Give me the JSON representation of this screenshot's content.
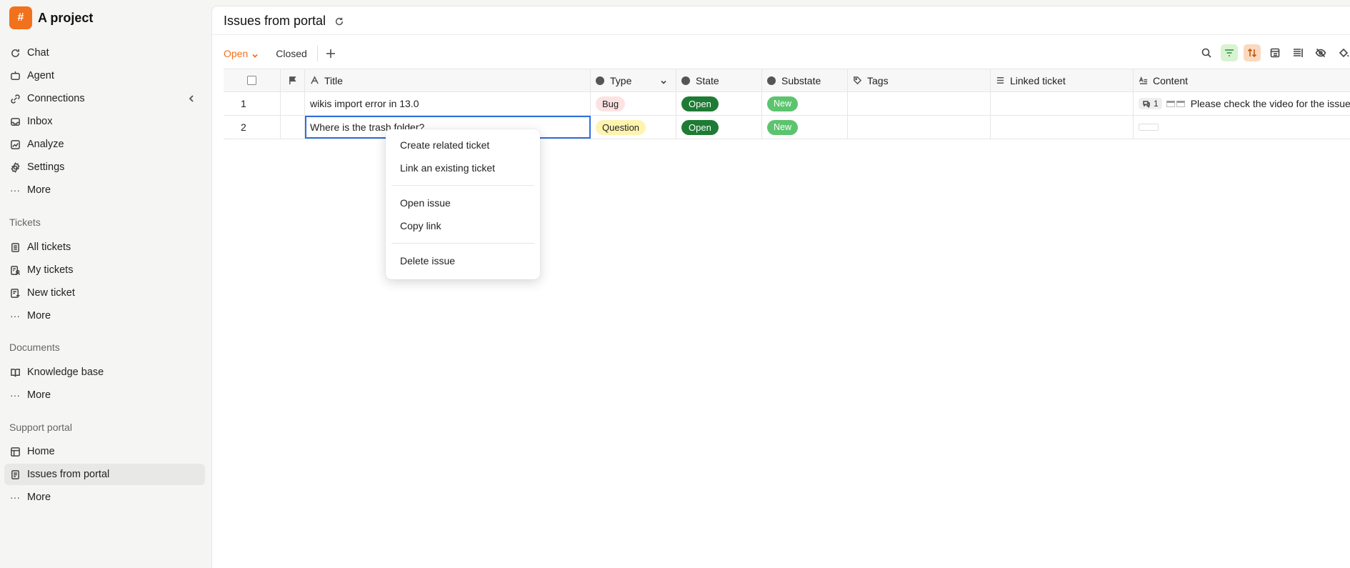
{
  "project": {
    "name": "A project",
    "logo_glyph": "#",
    "accent": "#f2711c"
  },
  "sidebar": {
    "main_items": [
      {
        "label": "Chat",
        "icon": "chat-icon"
      },
      {
        "label": "Agent",
        "icon": "agent-icon"
      },
      {
        "label": "Connections",
        "icon": "connections-icon"
      },
      {
        "label": "Inbox",
        "icon": "inbox-icon"
      },
      {
        "label": "Analyze",
        "icon": "analyze-icon"
      },
      {
        "label": "Settings",
        "icon": "settings-icon"
      },
      {
        "label": "More",
        "icon": "more-icon"
      }
    ],
    "tickets": {
      "heading": "Tickets",
      "items": [
        {
          "label": "All tickets",
          "icon": "tickets-list-icon"
        },
        {
          "label": "My tickets",
          "icon": "my-tickets-icon"
        },
        {
          "label": "New ticket",
          "icon": "new-ticket-icon"
        },
        {
          "label": "More",
          "icon": "more-icon"
        }
      ]
    },
    "documents": {
      "heading": "Documents",
      "items": [
        {
          "label": "Knowledge base",
          "icon": "book-icon"
        },
        {
          "label": "More",
          "icon": "more-icon"
        }
      ]
    },
    "support_portal": {
      "heading": "Support portal",
      "items": [
        {
          "label": "Home",
          "icon": "home-icon"
        },
        {
          "label": "Issues from portal",
          "icon": "issues-icon",
          "active": true
        },
        {
          "label": "More",
          "icon": "more-icon"
        }
      ]
    }
  },
  "header": {
    "title": "Issues from portal"
  },
  "tabs": {
    "open": "Open",
    "closed": "Closed"
  },
  "table": {
    "columns": {
      "title": "Title",
      "type": "Type",
      "state": "State",
      "substate": "Substate",
      "tags": "Tags",
      "linked": "Linked ticket",
      "content": "Content"
    },
    "rows": [
      {
        "num": "1",
        "title": "wikis import error in 13.0",
        "type": "Bug",
        "state": "Open",
        "substate": "New",
        "tags": "",
        "linked": "",
        "content_count": "1",
        "content": "Please check the video for the issue r"
      },
      {
        "num": "2",
        "title": "Where is the trash folder?",
        "type": "Question",
        "state": "Open",
        "substate": "New",
        "tags": "",
        "linked": "",
        "content_count": "",
        "content": ""
      }
    ]
  },
  "context_menu": {
    "create_related": "Create related ticket",
    "link_existing": "Link an existing ticket",
    "open_issue": "Open issue",
    "copy_link": "Copy link",
    "delete_issue": "Delete issue"
  }
}
